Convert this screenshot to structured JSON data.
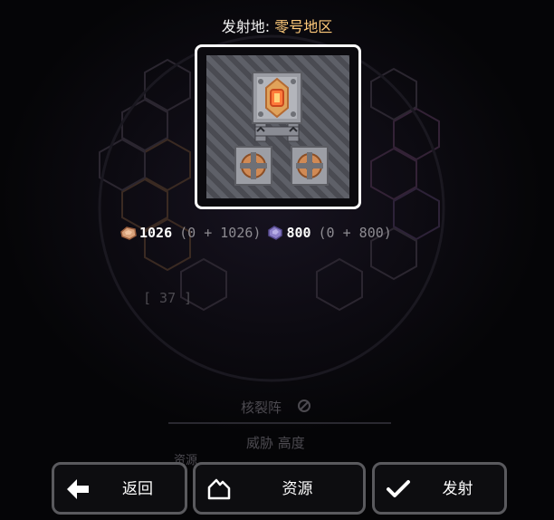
{
  "header": {
    "launch_prefix": "发射地: ",
    "launch_place": "零号地区"
  },
  "resources": {
    "copper": {
      "amount": "1026",
      "breakdown": "(0 + 1026)",
      "icon": "copper-ore-icon",
      "color": "#d9a37c"
    },
    "lead": {
      "amount": "800",
      "breakdown": "(0 + 800)",
      "icon": "lead-ore-icon",
      "color": "#8c7fc8"
    }
  },
  "background_info": {
    "wave_counter": "[ 37 ]",
    "sector_name": "核裂阵",
    "threat_label": "威胁 高度",
    "resources_label": "资源"
  },
  "buttons": {
    "back": {
      "label": "返回",
      "icon": "arrow-left-icon"
    },
    "resources": {
      "label": "资源",
      "icon": "house-outline-icon"
    },
    "launch": {
      "label": "发射",
      "icon": "checkmark-icon"
    }
  },
  "colors": {
    "accent": "#ffca7a",
    "frame": "#ffffff",
    "button_border": "#5a5a5e"
  }
}
